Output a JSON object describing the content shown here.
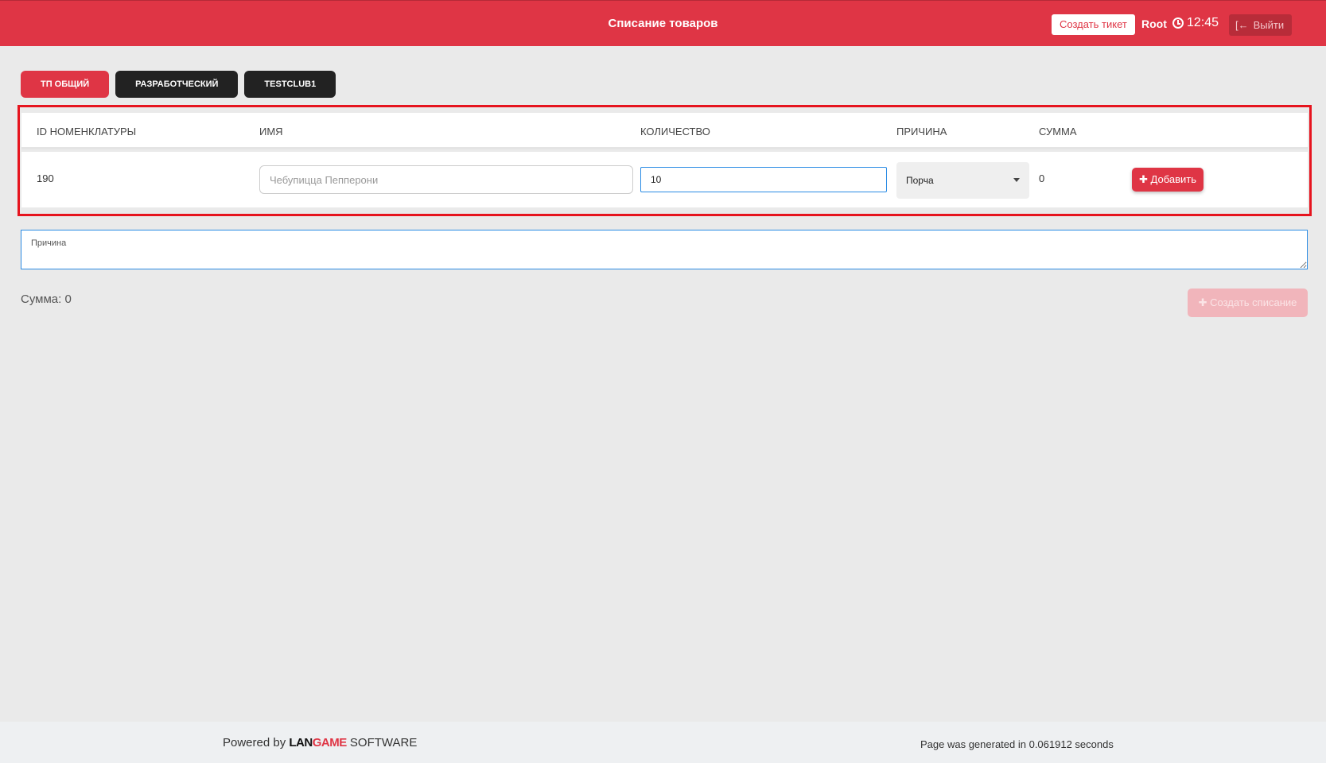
{
  "header": {
    "title": "Списание товаров",
    "create_ticket_label": "Создать тикет",
    "user": "Root",
    "time": "12:45",
    "logout_label": "Выйти"
  },
  "tabs": [
    {
      "label": "ТП ОБЩИЙ",
      "active": true
    },
    {
      "label": "РАЗРАБОТЧЕСКИЙ",
      "active": false
    },
    {
      "label": "TESTCLUB1",
      "active": false
    }
  ],
  "table": {
    "headers": [
      "ID НОМЕНКЛАТУРЫ",
      "ИМЯ",
      "КОЛИЧЕСТВО",
      "ПРИЧИНА",
      "СУММА"
    ],
    "row": {
      "id": "190",
      "name_placeholder": "Чебупицца Пепперони",
      "quantity": "10",
      "reason": "Порча",
      "sum": "0",
      "add_label": "Добавить"
    }
  },
  "reason_placeholder": "Причина",
  "total_label": "Сумма: 0",
  "create_writeoff_label": "Создать списание",
  "footer": {
    "powered_prefix": "Powered by",
    "brand_a": "LAN",
    "brand_b": "GAME",
    "brand_suffix": "SOFTWARE",
    "generated": "Page was generated in 0.061912 seconds"
  },
  "colors": {
    "primary": "#df3545",
    "dark": "#222222",
    "highlight": "#e6141e",
    "focus": "#2a8be4"
  }
}
